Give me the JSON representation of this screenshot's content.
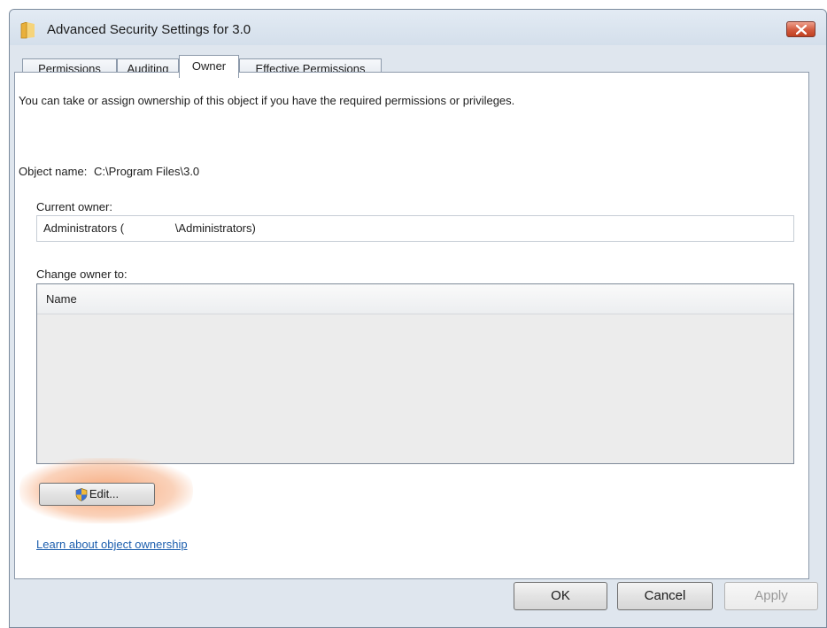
{
  "window": {
    "title": "Advanced Security Settings for 3.0"
  },
  "tabs": [
    {
      "label": "Permissions",
      "active": false
    },
    {
      "label": "Auditing",
      "active": false
    },
    {
      "label": "Owner",
      "active": true
    },
    {
      "label": "Effective Permissions",
      "active": false
    }
  ],
  "owner_tab": {
    "description": "You can take or assign ownership of this object if you have the required permissions or privileges.",
    "object_name_label": "Object name:",
    "object_name_value": "C:\\Program Files\\3.0",
    "current_owner_label": "Current owner:",
    "current_owner_value": "Administrators (                \\Administrators)",
    "change_owner_label": "Change owner to:",
    "list_column_header": "Name",
    "edit_button_label": "Edit...",
    "learn_link": "Learn about object ownership"
  },
  "footer": {
    "ok_label": "OK",
    "cancel_label": "Cancel",
    "apply_label": "Apply"
  },
  "icons": {
    "title_icon": "folder-icon",
    "close_icon": "close-icon",
    "edit_icon": "uac-shield-icon"
  },
  "colors": {
    "close_button": "#d25a3e",
    "link": "#1d5fae",
    "highlight": "#f5a06e"
  }
}
